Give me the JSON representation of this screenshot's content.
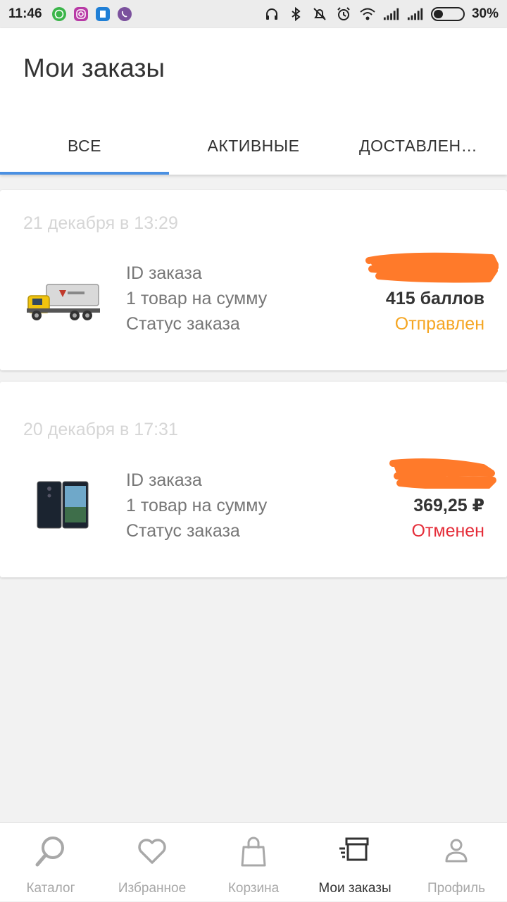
{
  "status_bar": {
    "time": "11:46",
    "battery_percent": "30%",
    "battery_level": 0.3,
    "app_icons": [
      "whatsapp-icon",
      "instagram-icon",
      "app-icon",
      "viber-icon"
    ],
    "system_icons": [
      "headphones-icon",
      "bluetooth-icon",
      "muted-icon",
      "alarm-icon",
      "wifi-icon",
      "signal-icon",
      "signal-icon"
    ]
  },
  "header": {
    "title": "Мои заказы",
    "tabs": [
      {
        "label": "ВСЕ",
        "active": true
      },
      {
        "label": "АКТИВНЫЕ",
        "active": false
      },
      {
        "label": "ДОСТАВЛЕННЫЕ",
        "active": false
      }
    ]
  },
  "orders": [
    {
      "date": "21 декабря в 13:29",
      "label_id": "ID заказа",
      "label_items": "1 товар на сумму",
      "label_status": "Статус заказа",
      "id_value": "",
      "amount": "415 баллов",
      "status": "Отправлен",
      "thumbnail": "toy-truck-image"
    },
    {
      "date": "20 декабря в 17:31",
      "label_id": "ID заказа",
      "label_items": "1 товар на сумму",
      "label_status": "Статус заказа",
      "id_value": "",
      "amount": "369,25 ₽",
      "status": "Отменен",
      "thumbnail": "smartphone-image"
    }
  ],
  "bottom_nav": [
    {
      "label": "Каталог",
      "icon": "search-icon",
      "active": false
    },
    {
      "label": "Избранное",
      "icon": "heart-icon",
      "active": false
    },
    {
      "label": "Корзина",
      "icon": "bag-icon",
      "active": false
    },
    {
      "label": "Мои заказы",
      "icon": "orders-icon",
      "active": true
    },
    {
      "label": "Профиль",
      "icon": "profile-icon",
      "active": false
    }
  ],
  "colors": {
    "accent": "#4a90e2",
    "status_shipped": "#f5a623",
    "status_cancelled": "#e52e3a",
    "redaction": "#ff7a2a"
  }
}
